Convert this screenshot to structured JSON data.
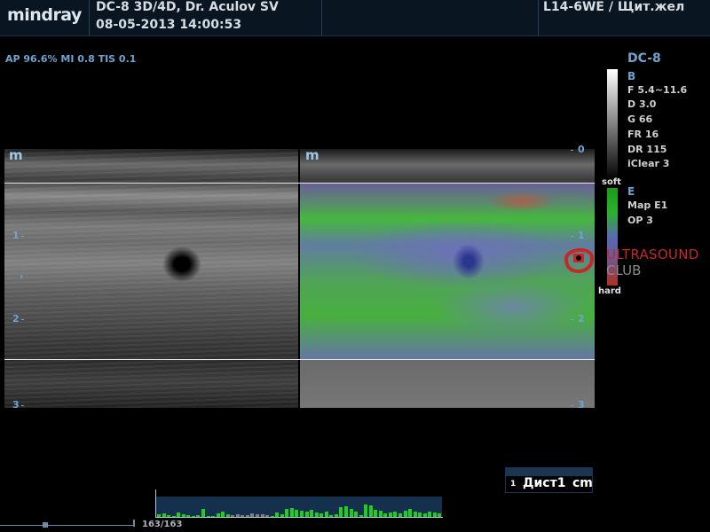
{
  "header": {
    "brand": "mindray",
    "info_line1": "DC-8 3D/4D, Dr. Aculov SV",
    "info_line2": "08-05-2013 14:00:53",
    "probe_preset": "L14-6WE / Щит.жел"
  },
  "acoustic_output": "AP 96.6%  MI 0.8  TIS 0.1",
  "image": {
    "left_mark": "m",
    "right_mark": "m",
    "left_depth_labels": [
      "1",
      "2",
      "3"
    ],
    "right_depth_labels": [
      "0",
      "1",
      "2",
      "3"
    ],
    "left_focus_marker": "›"
  },
  "params": {
    "title": "DC-8",
    "b_mode": "B",
    "b_values": [
      "F 5.4~11.6",
      "D 3.0",
      "G 66",
      "FR 16",
      "DR 115",
      "iClear 3"
    ],
    "e_mode": "E",
    "e_values": [
      "Map E1",
      "OP 3"
    ],
    "strain_soft": "soft",
    "strain_hard": "hard"
  },
  "watermark": {
    "line1": "ULTRASOUND",
    "line2": "CLUB"
  },
  "measurement": {
    "index": "1",
    "name": "Дист1",
    "unit": "cm"
  },
  "cine": {
    "frame_counter": "163/163",
    "bars": [
      3,
      4,
      2,
      1,
      5,
      3,
      2,
      1,
      2,
      9,
      1,
      1,
      4,
      6,
      3,
      2,
      3,
      2,
      2,
      4,
      3,
      3,
      2,
      1,
      5,
      3,
      9,
      10,
      8,
      7,
      6,
      8,
      5,
      4,
      6,
      2,
      3,
      11,
      12,
      9,
      6,
      2,
      14,
      13,
      8,
      7,
      4,
      5,
      6,
      4,
      7,
      9,
      6,
      5,
      4,
      6,
      5,
      4
    ]
  },
  "colors": {
    "accent_blue": "#6fa3d0",
    "cine_green": "#22cc22",
    "cine_gray": "#808080",
    "watermark_red": "#c42828"
  }
}
